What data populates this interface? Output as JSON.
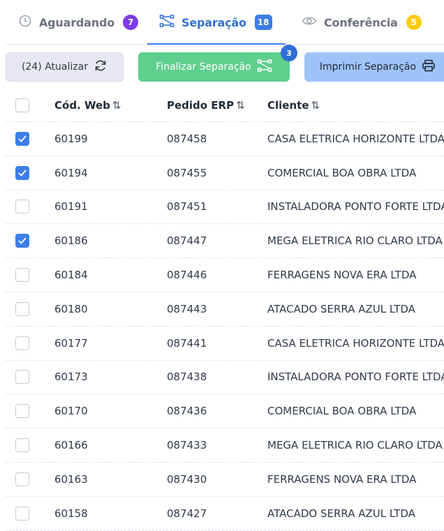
{
  "tabs": [
    {
      "label": "Aguardando",
      "badge": "7",
      "badge_color": "#7c3aed",
      "icon": "clock-icon"
    },
    {
      "label": "Separação",
      "badge": "18",
      "badge_color": "#3b7de9",
      "icon": "route-icon",
      "active": true
    },
    {
      "label": "Conferência",
      "badge": "5",
      "badge_color": "#facc15",
      "icon": "eye-icon"
    }
  ],
  "toolbar": {
    "refresh_label": "(24) Atualizar",
    "finalize_label": "Finalizar Separação",
    "finalize_badge": "3",
    "print_label": "Imprimir Separação"
  },
  "table": {
    "columns": [
      "Cód. Web",
      "Pedido ERP",
      "Cliente"
    ],
    "sort_glyph": "⇅",
    "rows": [
      {
        "checked": true,
        "web": "60199",
        "erp": "087458",
        "cliente": "CASA ELETRICA HORIZONTE LTDA"
      },
      {
        "checked": true,
        "web": "60194",
        "erp": "087455",
        "cliente": "COMERCIAL BOA OBRA LTDA"
      },
      {
        "checked": false,
        "web": "60191",
        "erp": "087451",
        "cliente": "INSTALADORA PONTO FORTE LTDA"
      },
      {
        "checked": true,
        "web": "60186",
        "erp": "087447",
        "cliente": "MEGA ELETRICA RIO CLARO LTDA"
      },
      {
        "checked": false,
        "web": "60184",
        "erp": "087446",
        "cliente": "FERRAGENS NOVA ERA LTDA"
      },
      {
        "checked": false,
        "web": "60180",
        "erp": "087443",
        "cliente": "ATACADO SERRA AZUL LTDA"
      },
      {
        "checked": false,
        "web": "60177",
        "erp": "087441",
        "cliente": "CASA ELETRICA HORIZONTE LTDA"
      },
      {
        "checked": false,
        "web": "60173",
        "erp": "087438",
        "cliente": "INSTALADORA PONTO FORTE LTDA"
      },
      {
        "checked": false,
        "web": "60170",
        "erp": "087436",
        "cliente": "COMERCIAL BOA OBRA LTDA"
      },
      {
        "checked": false,
        "web": "60166",
        "erp": "087433",
        "cliente": "MEGA ELETRICA RIO CLARO LTDA"
      },
      {
        "checked": false,
        "web": "60163",
        "erp": "087430",
        "cliente": "FERRAGENS NOVA ERA LTDA"
      },
      {
        "checked": false,
        "web": "60158",
        "erp": "087427",
        "cliente": "ATACADO SERRA AZUL LTDA"
      }
    ]
  }
}
